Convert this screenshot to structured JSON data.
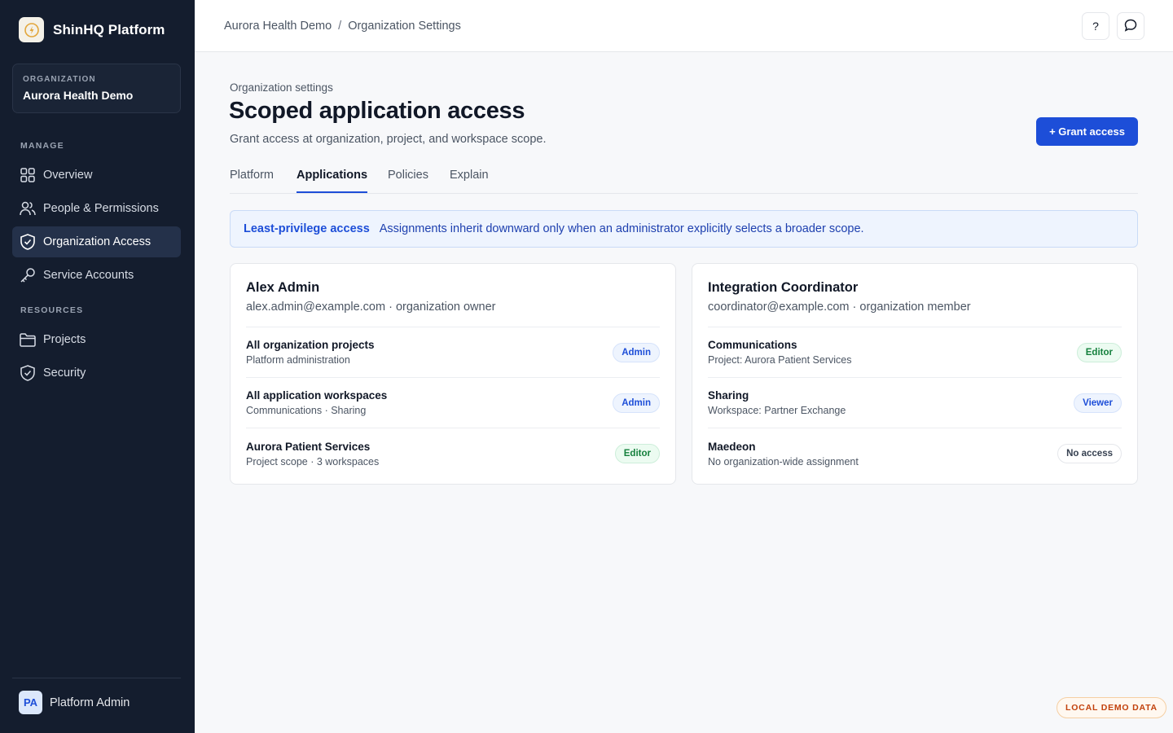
{
  "brand": {
    "name": "ShinHQ Platform"
  },
  "organization": {
    "label": "ORGANIZATION",
    "name": "Aurora Health Demo"
  },
  "nav": {
    "manage_label": "MANAGE",
    "resources_label": "RESOURCES",
    "items": [
      {
        "label": "Overview",
        "icon": "grid-icon"
      },
      {
        "label": "People & Permissions",
        "icon": "users-icon"
      },
      {
        "label": "Organization Access",
        "icon": "shield-icon",
        "active": true
      },
      {
        "label": "Service Accounts",
        "icon": "key-icon"
      },
      {
        "label": "Projects",
        "icon": "folder-icon"
      },
      {
        "label": "Security",
        "icon": "shield-check-icon"
      }
    ]
  },
  "user": {
    "initials": "PA",
    "name": "Platform Admin"
  },
  "breadcrumb": {
    "items": [
      "Aurora Health Demo",
      "Organization Settings"
    ],
    "separator": "/"
  },
  "topbar": {
    "help_label": "?"
  },
  "header": {
    "eyebrow": "Organization settings",
    "title": "Scoped application access",
    "subtitle": "Grant access at organization, project, and workspace scope.",
    "grant_button": "+ Grant access"
  },
  "tabs": [
    {
      "label": "Platform"
    },
    {
      "label": "Applications",
      "active": true
    },
    {
      "label": "Policies"
    },
    {
      "label": "Explain"
    }
  ],
  "banner": {
    "title": "Least-privilege access",
    "text": "Assignments inherit downward only when an administrator explicitly selects a broader scope."
  },
  "cards": [
    {
      "name": "Alex Admin",
      "subtitle": "alex.admin@example.com · organization owner",
      "rows": [
        {
          "title": "All organization projects",
          "detail": "Platform administration",
          "role": "Admin"
        },
        {
          "title": "All application workspaces",
          "detail": "Communications · Sharing",
          "role": "Admin"
        },
        {
          "title": "Aurora Patient Services",
          "detail": "Project scope · 3 workspaces",
          "role": "Editor"
        }
      ]
    },
    {
      "name": "Integration Coordinator",
      "subtitle": "coordinator@example.com · organization member",
      "rows": [
        {
          "title": "Communications",
          "detail": "Project: Aurora Patient Services",
          "role": "Editor"
        },
        {
          "title": "Sharing",
          "detail": "Workspace: Partner Exchange",
          "role": "Viewer"
        },
        {
          "title": "Maedeon",
          "detail": "No organization-wide assignment",
          "role": "No access"
        }
      ]
    }
  ],
  "demo_badge": "LOCAL DEMO DATA",
  "colors": {
    "sidebar_bg": "#141d2e",
    "accent": "#1d4ed8",
    "editor": "#15803d",
    "demo": "#c2410c"
  }
}
